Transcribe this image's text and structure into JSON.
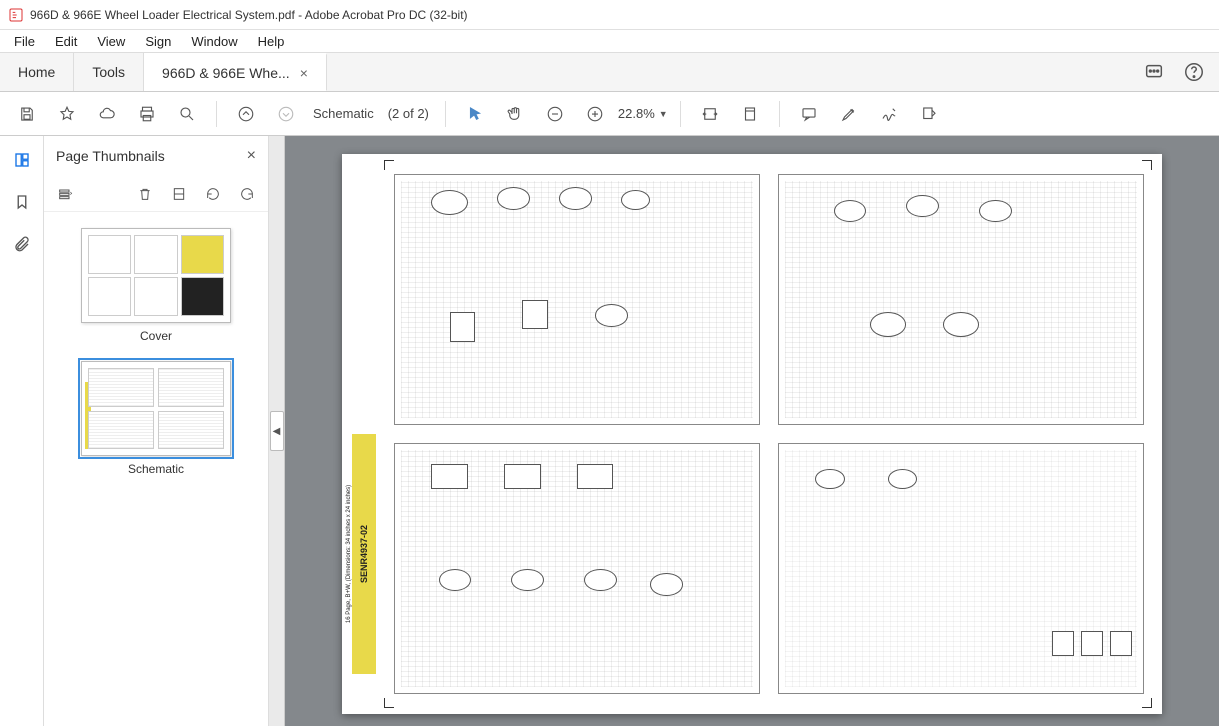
{
  "window": {
    "title": "966D & 966E Wheel Loader Electrical System.pdf - Adobe Acrobat Pro DC (32-bit)"
  },
  "menu": {
    "file": "File",
    "edit": "Edit",
    "view": "View",
    "sign": "Sign",
    "window": "Window",
    "help": "Help"
  },
  "tabs": {
    "home": "Home",
    "tools": "Tools",
    "doc": "966D & 966E Whe..."
  },
  "toolbar": {
    "page_label": "Schematic",
    "page_count": "(2 of 2)",
    "zoom": "22.8%"
  },
  "panel": {
    "title": "Page Thumbnails"
  },
  "thumbs": {
    "cover": "Cover",
    "schematic": "Schematic"
  },
  "document": {
    "spine_code": "SENR4937-02",
    "spine_note": "16 Page, B+W, (Dimensions: 34 inches x 24 inches)"
  }
}
